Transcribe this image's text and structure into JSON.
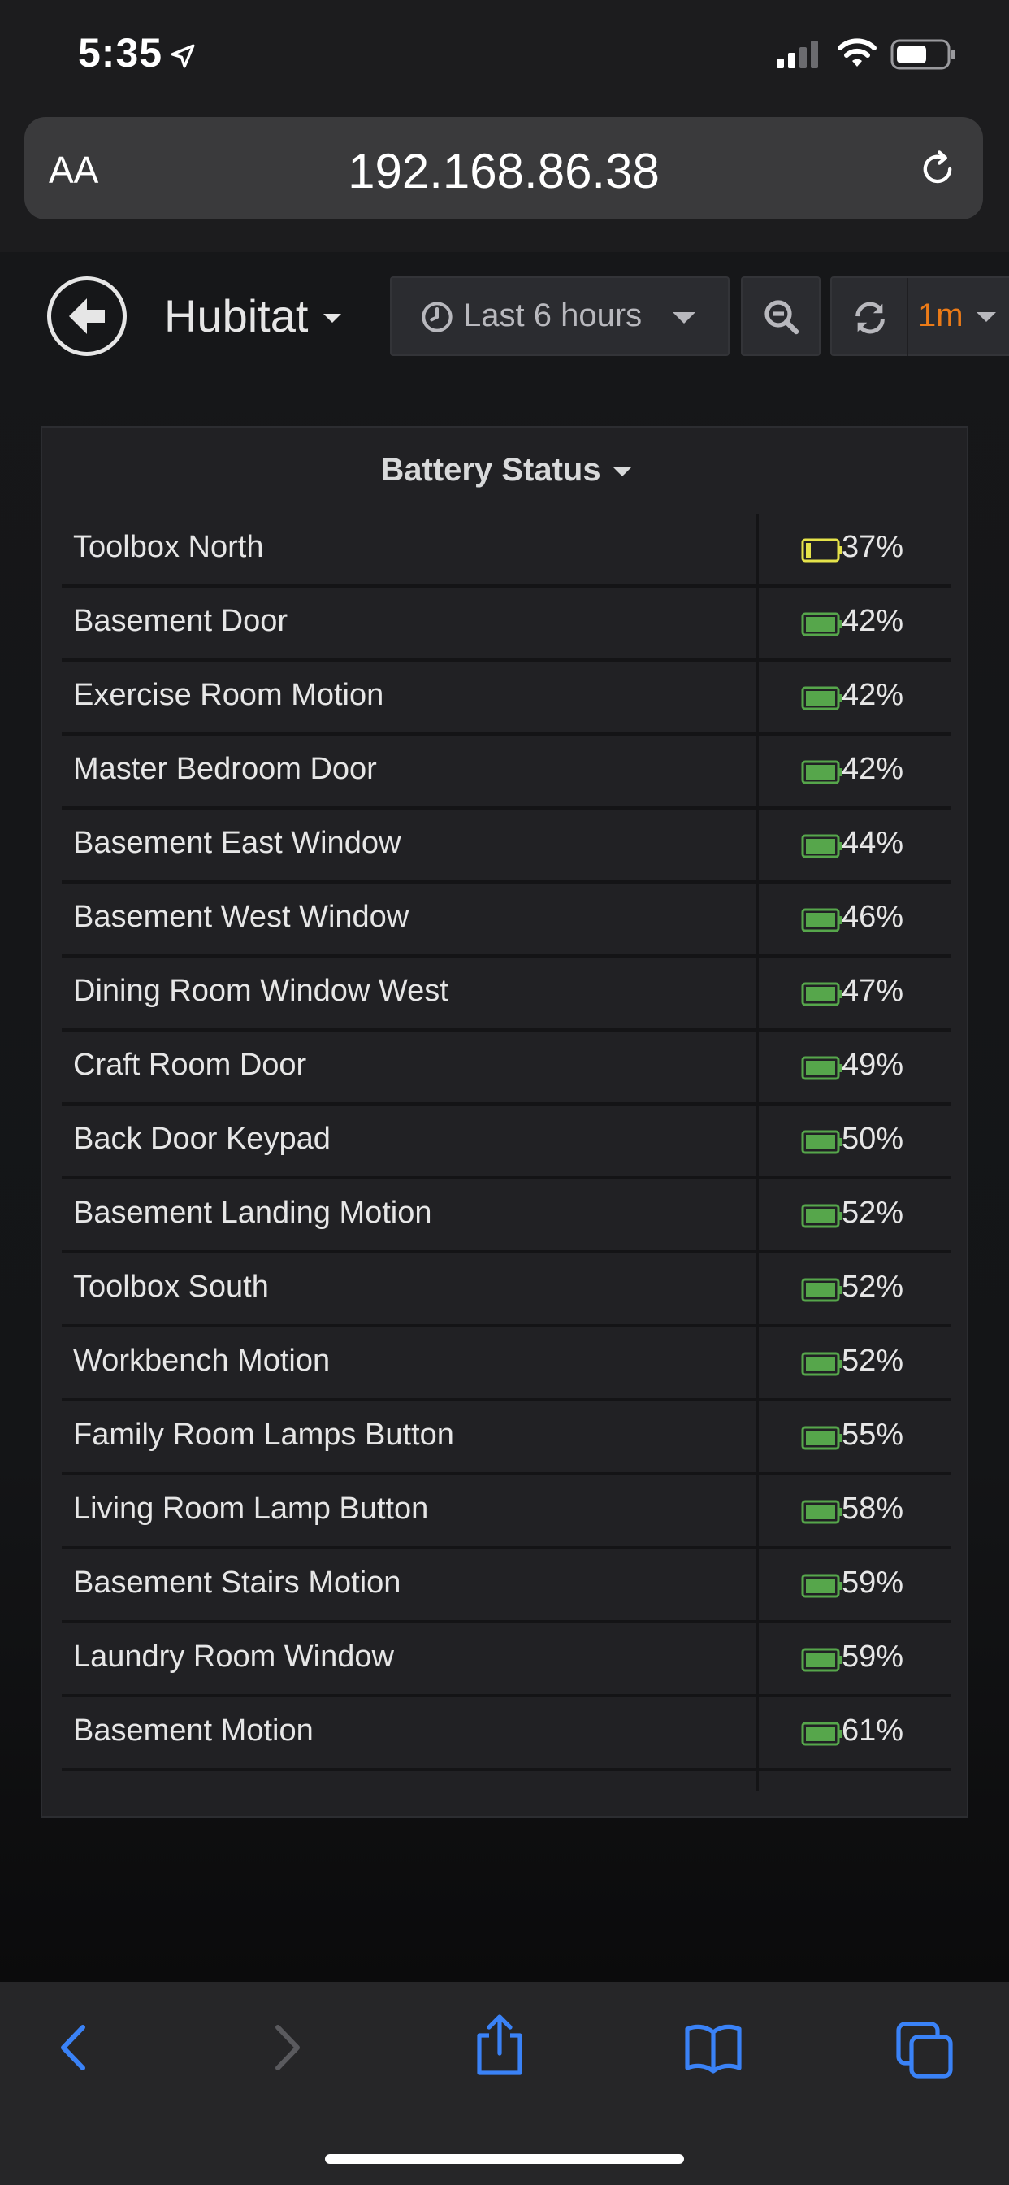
{
  "status_bar": {
    "time": "5:35"
  },
  "browser": {
    "text_size_label": "AA",
    "url": "192.168.86.38"
  },
  "dashboard": {
    "title": "Hubitat",
    "time_range": "Last 6 hours",
    "refresh_interval": "1m",
    "colors": {
      "accent_refresh": "#eb7b18",
      "battery_low": "#e5e34a",
      "battery_ok": "#56a64b"
    }
  },
  "panel": {
    "title": "Battery Status",
    "rows": [
      {
        "name": "Toolbox North",
        "value": "37%",
        "level": "low"
      },
      {
        "name": "Basement Door",
        "value": "42%",
        "level": "ok"
      },
      {
        "name": "Exercise Room Motion",
        "value": "42%",
        "level": "ok"
      },
      {
        "name": "Master Bedroom Door",
        "value": "42%",
        "level": "ok"
      },
      {
        "name": "Basement East Window",
        "value": "44%",
        "level": "ok"
      },
      {
        "name": "Basement West Window",
        "value": "46%",
        "level": "ok"
      },
      {
        "name": "Dining Room Window West",
        "value": "47%",
        "level": "ok"
      },
      {
        "name": "Craft Room Door",
        "value": "49%",
        "level": "ok"
      },
      {
        "name": "Back Door Keypad",
        "value": "50%",
        "level": "ok"
      },
      {
        "name": "Basement Landing Motion",
        "value": "52%",
        "level": "ok"
      },
      {
        "name": "Toolbox South",
        "value": "52%",
        "level": "ok"
      },
      {
        "name": "Workbench Motion",
        "value": "52%",
        "level": "ok"
      },
      {
        "name": "Family Room Lamps Button",
        "value": "55%",
        "level": "ok"
      },
      {
        "name": "Living Room Lamp Button",
        "value": "58%",
        "level": "ok"
      },
      {
        "name": "Basement Stairs Motion",
        "value": "59%",
        "level": "ok"
      },
      {
        "name": "Laundry Room Window",
        "value": "59%",
        "level": "ok"
      },
      {
        "name": "Basement Motion",
        "value": "61%",
        "level": "ok"
      }
    ]
  },
  "toolbar_icons": [
    "back-icon",
    "forward-icon",
    "share-icon",
    "bookmarks-icon",
    "tabs-icon"
  ]
}
